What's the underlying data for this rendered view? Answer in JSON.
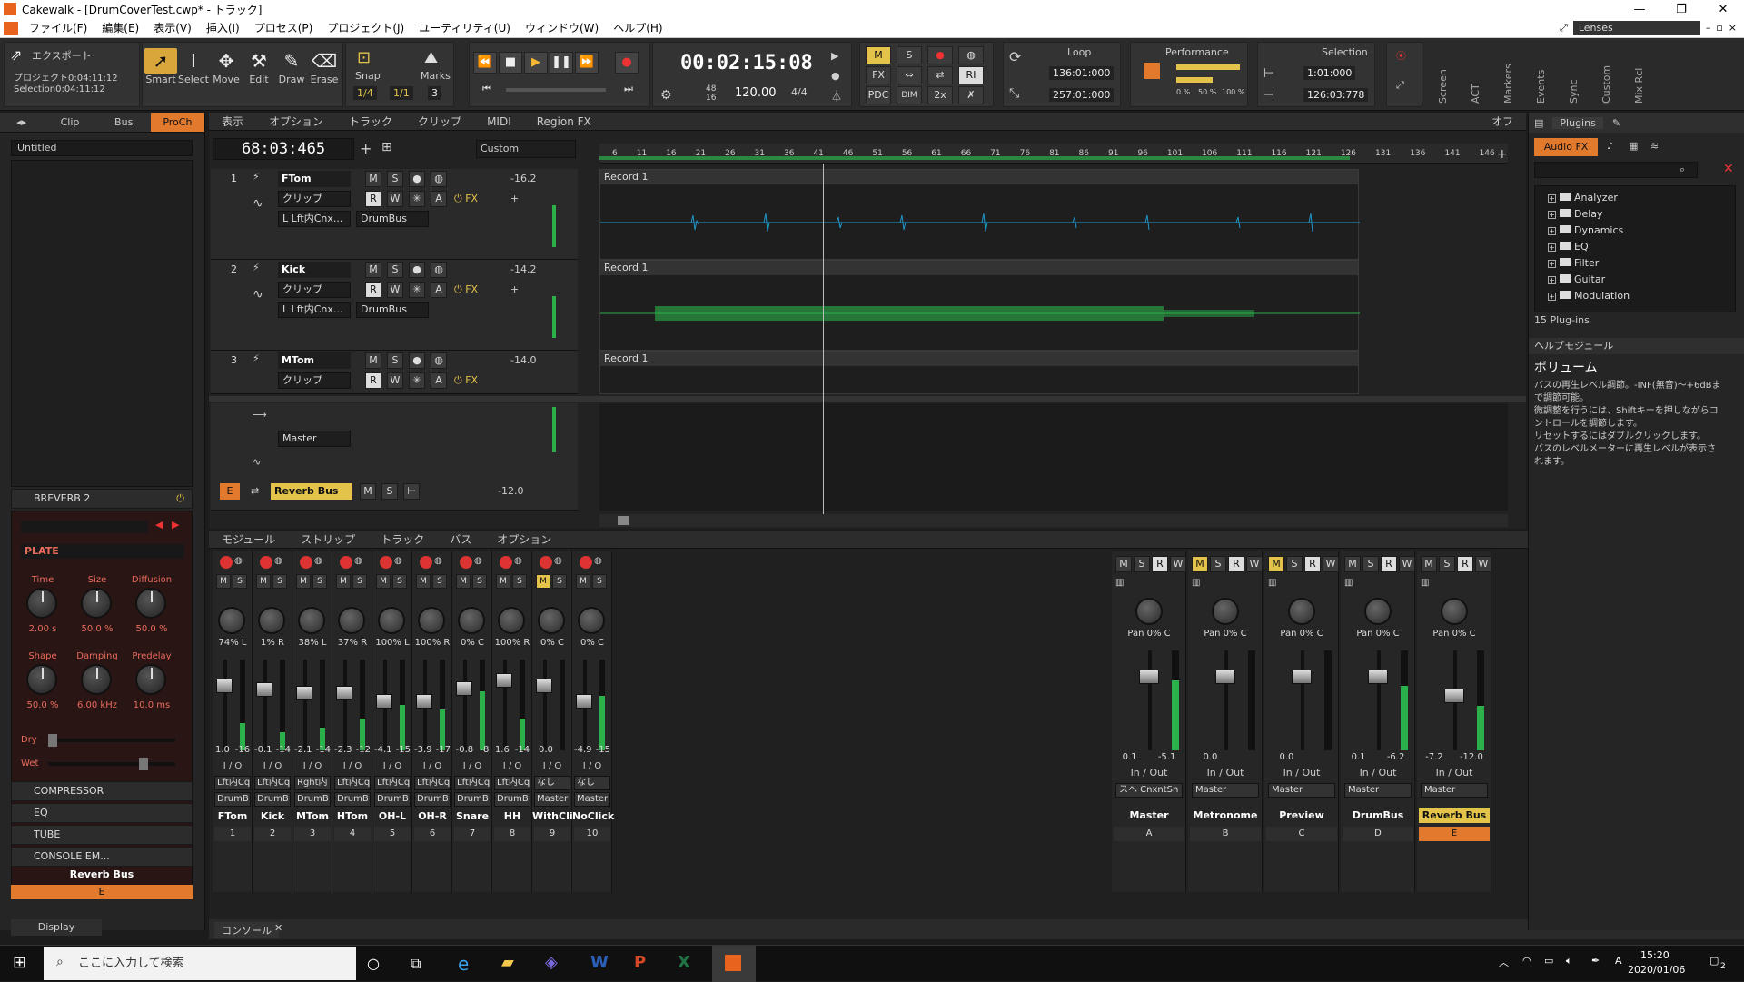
{
  "window": {
    "title": "Cakewalk - [DrumCoverTest.cwp* - トラック]"
  },
  "menu": [
    "ファイル(F)",
    "編集(E)",
    "表示(V)",
    "挿入(I)",
    "プロセス(P)",
    "プロジェクト(J)",
    "ユーティリティ(U)",
    "ウィンドウ(W)",
    "ヘルプ(H)"
  ],
  "lenses": "Lenses",
  "toolbar": {
    "export": "エクスポート",
    "project_range": "プロジェクト0:04:11:12",
    "selection_range": "Selection0:04:11:12",
    "tools": [
      "Smart",
      "Select",
      "Move",
      "Edit",
      "Draw",
      "Erase"
    ],
    "snap": "Snap",
    "marks": "Marks",
    "snap_val": "1/4",
    "snap_val2": "1/1",
    "snap_num": "3",
    "time": "00:02:15:08",
    "tempo": "120.00",
    "meter": "4/4",
    "bits_top": "48",
    "bits_bottom": "16",
    "mix_buttons": [
      "M",
      "S",
      "●",
      "FX",
      "PDC",
      "DIM",
      "2x",
      "RI"
    ],
    "loop_label": "Loop",
    "loop_start": "136:01:000",
    "loop_end": "257:01:000",
    "perf_label": "Performance",
    "perf_vals": [
      "0 %",
      "50 %",
      "100 %"
    ],
    "sel_label": "Selection",
    "sel_start": "1:01:000",
    "sel_end": "126:03:778",
    "side_labels": [
      "Screen",
      "ACT",
      "Markers",
      "Events",
      "Sync",
      "Custom",
      "Mix Rcl"
    ]
  },
  "inspector": {
    "tabs": [
      "Clip",
      "Bus",
      "ProCh"
    ],
    "preset": "Untitled",
    "reverb_name": "BREVERB 2",
    "reverb_type": "PLATE",
    "knobs": [
      {
        "label": "Time",
        "value": "2.00 s"
      },
      {
        "label": "Size",
        "value": "50.0 %"
      },
      {
        "label": "Diffusion",
        "value": "50.0 %"
      },
      {
        "label": "Shape",
        "value": "50.0 %"
      },
      {
        "label": "Damping",
        "value": "6.00 kHz"
      },
      {
        "label": "Predelay",
        "value": "10.0 ms"
      }
    ],
    "dry": "Dry",
    "wet": "Wet",
    "modules": [
      "COMPRESSOR",
      "EQ",
      "TUBE",
      "CONSOLE EM..."
    ],
    "bus_name": "Reverb Bus",
    "bus_letter": "E",
    "display": "Display"
  },
  "tracks_pane": {
    "menu": [
      "表示",
      "オプション",
      "トラック",
      "クリップ",
      "MIDI",
      "Region FX"
    ],
    "off": "オフ",
    "now": "68:03:465",
    "custom": "Custom",
    "ruler_marks": [
      "6",
      "11",
      "16",
      "21",
      "26",
      "31",
      "36",
      "41",
      "46",
      "51",
      "56",
      "61",
      "66",
      "71",
      "76",
      "81",
      "86",
      "91",
      "96",
      "101",
      "106",
      "111",
      "116",
      "121",
      "126",
      "131",
      "136",
      "141",
      "146"
    ],
    "tracks": [
      {
        "num": "1",
        "name": "FTom",
        "level": "-16.2",
        "clip": "クリップ",
        "in": "L Lft内Cnx...",
        "out": "DrumBus",
        "clipname": "Record 1"
      },
      {
        "num": "2",
        "name": "Kick",
        "level": "-14.2",
        "clip": "クリップ",
        "in": "L Lft内Cnx...",
        "out": "DrumBus",
        "clipname": "Record 1"
      },
      {
        "num": "3",
        "name": "MTom",
        "level": "-14.0",
        "clip": "クリップ",
        "in": "",
        "out": "",
        "clipname": "Record 1"
      }
    ],
    "bus_out": "Master",
    "bus_name": "Reverb Bus",
    "bus_letter": "E",
    "bus_level": "-12.0"
  },
  "console": {
    "menu": [
      "モジュール",
      "ストリップ",
      "トラック",
      "バス",
      "オプション"
    ],
    "strips": [
      {
        "pan": "74% L",
        "vals": [
          "1.0",
          "-16"
        ],
        "io": "I / O",
        "in": "Lft内Cq",
        "out": "DrumB",
        "name": "FTom",
        "num": "1",
        "fader": 0.75,
        "meter": 0.3
      },
      {
        "pan": "1% R",
        "vals": [
          "-0.1",
          "-14"
        ],
        "io": "I / O",
        "in": "Lft内Cq",
        "out": "DrumB",
        "name": "Kick",
        "num": "2",
        "fader": 0.7,
        "meter": 0.2
      },
      {
        "pan": "38% L",
        "vals": [
          "-2.1",
          "-14"
        ],
        "io": "I / O",
        "in": "Rght内",
        "out": "DrumB",
        "name": "MTom",
        "num": "3",
        "fader": 0.65,
        "meter": 0.25
      },
      {
        "pan": "37% R",
        "vals": [
          "-2.3",
          "-12"
        ],
        "io": "I / O",
        "in": "Lft内Cq",
        "out": "DrumB",
        "name": "HTom",
        "num": "4",
        "fader": 0.65,
        "meter": 0.35
      },
      {
        "pan": "100% L",
        "vals": [
          "-4.1",
          "-15"
        ],
        "io": "I / O",
        "in": "Lft内Cq",
        "out": "DrumB",
        "name": "OH-L",
        "num": "5",
        "fader": 0.55,
        "meter": 0.5
      },
      {
        "pan": "100% R",
        "vals": [
          "-3.9",
          "-17"
        ],
        "io": "I / O",
        "in": "Lft内Cq",
        "out": "DrumB",
        "name": "OH-R",
        "num": "6",
        "fader": 0.55,
        "meter": 0.45
      },
      {
        "pan": "0% C",
        "vals": [
          "-0.8",
          "-8"
        ],
        "io": "I / O",
        "in": "Lft内Cq",
        "out": "DrumB",
        "name": "Snare",
        "num": "7",
        "fader": 0.72,
        "meter": 0.65
      },
      {
        "pan": "100% R",
        "vals": [
          "1.6",
          "-14"
        ],
        "io": "I / O",
        "in": "Lft内Cq",
        "out": "DrumB",
        "name": "HH",
        "num": "8",
        "fader": 0.82,
        "meter": 0.35
      },
      {
        "pan": "0% C",
        "vals": [
          "0.0",
          ""
        ],
        "io": "I / O",
        "in": "なし",
        "out": "Master",
        "name": "WithCli",
        "num": "9",
        "fader": 0.75,
        "meter": 0.0
      },
      {
        "pan": "0% C",
        "vals": [
          "-4.9",
          "-15"
        ],
        "io": "I / O",
        "in": "なし",
        "out": "Master",
        "name": "NoClick",
        "num": "10",
        "fader": 0.55,
        "meter": 0.6
      }
    ],
    "buses": [
      {
        "pan": "Pan 0% C",
        "vals": [
          "0.1",
          "-5.1"
        ],
        "inout": "In / Out",
        "out": "スへ CnxntSn",
        "name": "Master",
        "letter": "A",
        "fader": 0.78,
        "meter": 0.7,
        "highlight": false
      },
      {
        "pan": "Pan 0% C",
        "vals": [
          "0.0",
          ""
        ],
        "inout": "In / Out",
        "out": "Master",
        "name": "Metronome",
        "letter": "B",
        "fader": 0.78,
        "meter": 0.0,
        "highlight": false
      },
      {
        "pan": "Pan 0% C",
        "vals": [
          "0.0",
          ""
        ],
        "inout": "In / Out",
        "out": "Master",
        "name": "Preview",
        "letter": "C",
        "fader": 0.78,
        "meter": 0.0,
        "highlight": false
      },
      {
        "pan": "Pan 0% C",
        "vals": [
          "0.1",
          "-6.2"
        ],
        "inout": "In / Out",
        "out": "Master",
        "name": "DrumBus",
        "letter": "D",
        "fader": 0.78,
        "meter": 0.65,
        "highlight": false
      },
      {
        "pan": "Pan 0% C",
        "vals": [
          "-7.2",
          "-12.0"
        ],
        "inout": "In / Out",
        "out": "Master",
        "name": "Reverb Bus",
        "letter": "E",
        "fader": 0.55,
        "meter": 0.45,
        "highlight": true
      }
    ],
    "tab": "コンソール"
  },
  "browser": {
    "tab": "Plugins",
    "sub": "Audio FX",
    "folders": [
      "Analyzer",
      "Delay",
      "Dynamics",
      "EQ",
      "Filter",
      "Guitar",
      "Modulation"
    ],
    "count": "15 Plug-ins",
    "help_title": "ヘルプモジュール",
    "help_heading": "ボリューム",
    "help_lines": [
      "バスの再生レベル調節。-INF(無音)～+6dBまで調節可能。",
      "微調整を行うには、Shiftキーを押しながらコントロールを調節します。",
      "リセットするにはダブルクリックします。",
      "バスのレベルメーターに再生レベルが表示されます。"
    ]
  },
  "taskbar": {
    "search": "ここに入力して検索",
    "time": "15:20",
    "date": "2020/01/06",
    "ime": "A",
    "notif": "2"
  },
  "colors": {
    "accent": "#e27a2e",
    "yellow": "#e4c34a",
    "meter": "#2bb04a",
    "wave": "#2196c9",
    "wave2": "#2bb04a"
  }
}
